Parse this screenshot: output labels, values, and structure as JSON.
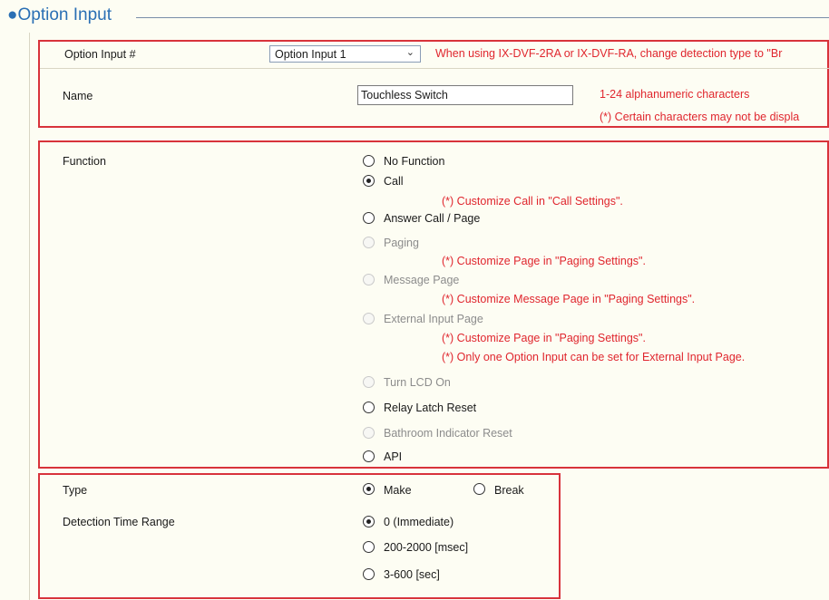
{
  "section": {
    "title": "●Option Input"
  },
  "option_input": {
    "label": "Option Input #",
    "selected": "Option Input 1",
    "note": "When using IX-DVF-2RA or IX-DVF-RA, change detection  type to \"Br"
  },
  "name": {
    "label": "Name",
    "value": "Touchless Switch",
    "note1": "1-24 alphanumeric characters",
    "note2": "(*) Certain characters may not be displa"
  },
  "function": {
    "label": "Function",
    "options": [
      {
        "label": "No Function",
        "checked": false,
        "disabled": false
      },
      {
        "label": "Call",
        "checked": true,
        "disabled": false
      },
      {
        "label": "Answer Call / Page",
        "checked": false,
        "disabled": false
      },
      {
        "label": "Paging",
        "checked": false,
        "disabled": true
      },
      {
        "label": "Message Page",
        "checked": false,
        "disabled": true
      },
      {
        "label": "External Input Page",
        "checked": false,
        "disabled": true
      },
      {
        "label": "Turn LCD On",
        "checked": false,
        "disabled": true
      },
      {
        "label": "Relay Latch Reset",
        "checked": false,
        "disabled": false
      },
      {
        "label": "Bathroom Indicator Reset",
        "checked": false,
        "disabled": true
      },
      {
        "label": "API",
        "checked": false,
        "disabled": false
      }
    ],
    "notes": {
      "call": "(*) Customize Call in \"Call Settings\".",
      "paging": "(*) Customize Page in \"Paging Settings\".",
      "message": "(*) Customize Message Page in \"Paging Settings\".",
      "external1": "(*) Customize Page in \"Paging Settings\".",
      "external2": "(*) Only one Option Input can be set for External Input Page."
    }
  },
  "type": {
    "label": "Type",
    "options": [
      {
        "label": "Make",
        "checked": true
      },
      {
        "label": "Break",
        "checked": false
      }
    ]
  },
  "detection": {
    "label": "Detection Time Range",
    "options": [
      {
        "label": "0 (Immediate)",
        "checked": true
      },
      {
        "label": "200-2000 [msec]",
        "checked": false
      },
      {
        "label": "3-600 [sec]",
        "checked": false
      }
    ]
  },
  "colors": {
    "accent": "#d8333b",
    "note": "#e0262e",
    "title": "#2a6fb4"
  }
}
